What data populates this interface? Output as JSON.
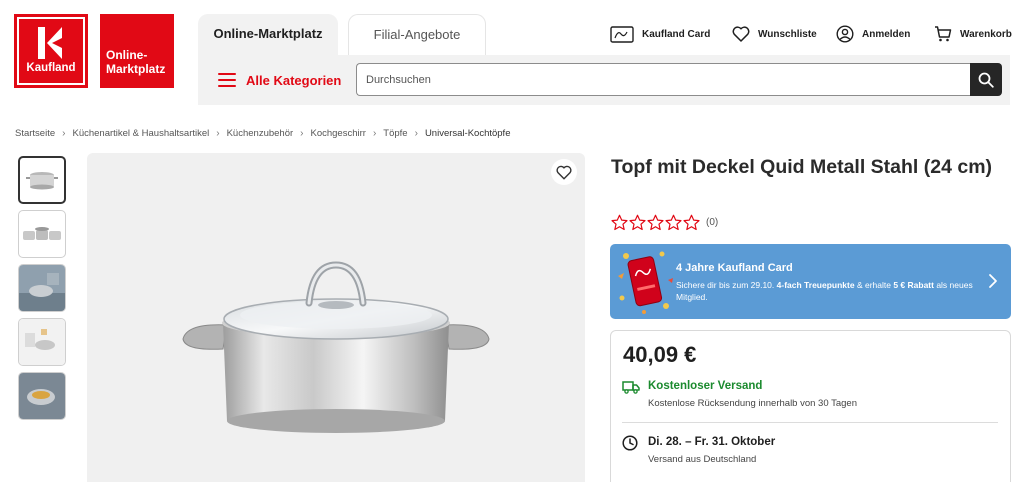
{
  "brand": {
    "name": "Kaufland",
    "subtitle": "Online-Marktplatz",
    "color": "#e10915"
  },
  "tabs": [
    {
      "label": "Online-Marktplatz",
      "active": true
    },
    {
      "label": "Filial-Angebote",
      "active": false
    }
  ],
  "header_links": [
    {
      "label": "Kaufland Card",
      "icon": "kaufland-card-icon"
    },
    {
      "label": "Wunschliste",
      "icon": "heart-icon"
    },
    {
      "label": "Anmelden",
      "icon": "user-icon"
    },
    {
      "label": "Warenkorb",
      "icon": "cart-icon"
    }
  ],
  "all_categories": {
    "label": "Alle Kategorien",
    "icon": "hamburger-icon"
  },
  "search": {
    "placeholder": "Durchsuchen",
    "value": "",
    "icon": "search-icon"
  },
  "breadcrumb": [
    "Startseite",
    "Küchenartikel & Haushaltsartikel",
    "Küchenzubehör",
    "Kochgeschirr",
    "Töpfe",
    "Universal-Kochtöpfe"
  ],
  "product": {
    "title": "Topf mit Deckel Quid Metall Stahl (24 cm)",
    "rating": {
      "stars": 0,
      "max": 5,
      "count": "(0)"
    },
    "thumbnails": 5
  },
  "promo": {
    "title": "4 Jahre Kaufland Card",
    "text_1": "Sichere dir bis zum 29.10. ",
    "text_bold_1": "4-fach Treuepunkte",
    "text_2": " & erhalte ",
    "text_bold_2": "5 € Rabatt",
    "text_3": " als neues Mitglied.",
    "background": "#5b9bd5"
  },
  "buybox": {
    "price": "40,09 €",
    "shipping_title": "Kostenloser Versand",
    "shipping_sub": "Kostenlose Rücksendung innerhalb von 30 Tagen",
    "delivery_title": "Di. 28. – Fr. 31. Oktober",
    "delivery_sub": "Versand aus Deutschland",
    "shipping_color": "#1b8a2e"
  }
}
